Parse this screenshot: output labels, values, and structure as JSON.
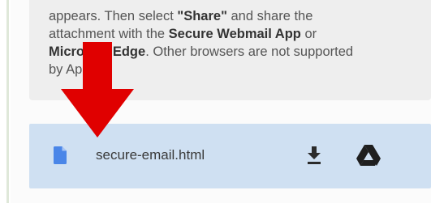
{
  "instructions": {
    "line1_start": "appears. Then select ",
    "share_label": "\"Share\"",
    "line1_end": " and share the",
    "line2_start": "attachment with the ",
    "app_name": "Secure Webmail App",
    "line2_end": " or",
    "browser_name": "Microsoft Edge",
    "line3_end": ". Other browsers are not supported",
    "line4": "by Apple."
  },
  "attachment": {
    "file_name": "secure-email.html",
    "file_icon": "document-icon",
    "download_icon": "download-icon",
    "drive_icon": "google-drive-icon"
  },
  "colors": {
    "instructions_background": "#eeeeee",
    "attachment_background": "#cfe0f2",
    "file_icon_color": "#4a86e8",
    "overlay_arrow": "#e00000"
  }
}
